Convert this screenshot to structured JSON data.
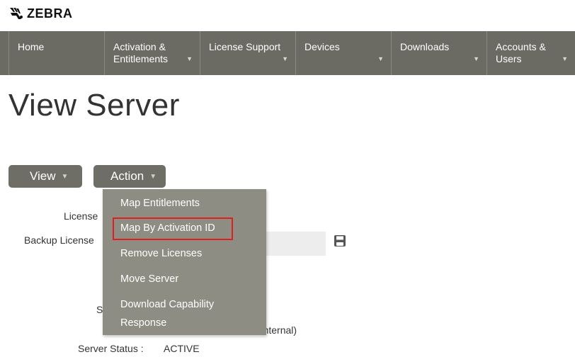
{
  "brand": {
    "logo_text": "ZEBRA"
  },
  "nav": {
    "items": [
      {
        "label_line1": "Home",
        "label_line2": "",
        "caret": ""
      },
      {
        "label_line1": "Activation &",
        "label_line2": "Entitlements",
        "caret": "▼"
      },
      {
        "label_line1": "License Support",
        "label_line2": "",
        "caret": "▼"
      },
      {
        "label_line1": "Devices",
        "label_line2": "",
        "caret": "▼"
      },
      {
        "label_line1": "Downloads",
        "label_line2": "",
        "caret": "▼"
      },
      {
        "label_line1": "Accounts &",
        "label_line2": "Users",
        "caret": "▼"
      }
    ]
  },
  "page": {
    "title": "View Server"
  },
  "toolbar": {
    "view_label": "View",
    "action_label": "Action",
    "caret": "▼"
  },
  "form": {
    "license_label": "License",
    "backup_label": "Backup License",
    "partial_s": "S",
    "partial_internal": "a Internal)",
    "status_label": "Server Status :",
    "status_value": "ACTIVE"
  },
  "action_menu": {
    "items": [
      "Map Entitlements",
      "Map By Activation ID",
      "Remove Licenses",
      "Move Server",
      "Download Capability",
      "Response"
    ],
    "highlighted_item": "Map By Activation ID",
    "highlight_color": "#e02020"
  },
  "colors": {
    "nav_bg": "#6b6b64",
    "button_bg": "#6e6e66",
    "menu_bg": "#8d8d84"
  }
}
